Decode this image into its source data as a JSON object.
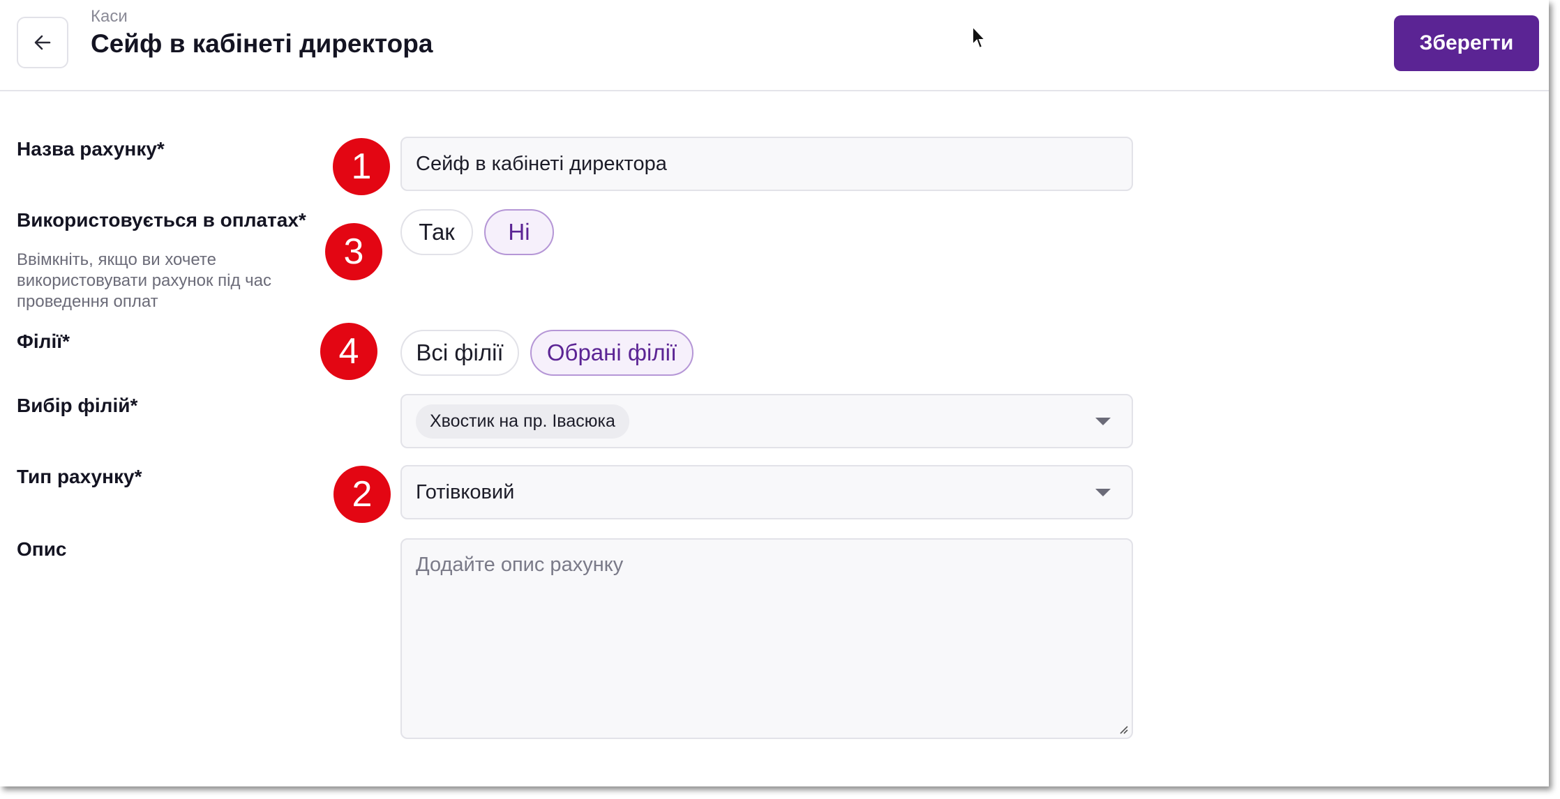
{
  "header": {
    "breadcrumb": "Каси",
    "title": "Сейф в кабінеті директора",
    "save_label": "Зберегти"
  },
  "form": {
    "account_name": {
      "label": "Назва рахунку*",
      "value": "Сейф в кабінеті директора"
    },
    "used_in_payments": {
      "label": "Використовується в оплатах*",
      "hint": "Ввімкніть, якщо ви хочете використовувати рахунок під час проведення оплат",
      "options": [
        "Так",
        "Ні"
      ],
      "selected": "Ні"
    },
    "branches": {
      "label": "Філії*",
      "options": [
        "Всі філії",
        "Обрані філії"
      ],
      "selected": "Обрані філії"
    },
    "branch_select": {
      "label": "Вибір філій*",
      "tags": [
        "Хвостик на пр. Івасюка"
      ]
    },
    "account_type": {
      "label": "Тип рахунку*",
      "value": "Готівковий"
    },
    "description": {
      "label": "Опис",
      "placeholder": "Додайте опис рахунку"
    }
  },
  "markers": [
    "1",
    "3",
    "4",
    "2"
  ],
  "colors": {
    "accent": "#5b2494",
    "marker": "#e30613"
  }
}
